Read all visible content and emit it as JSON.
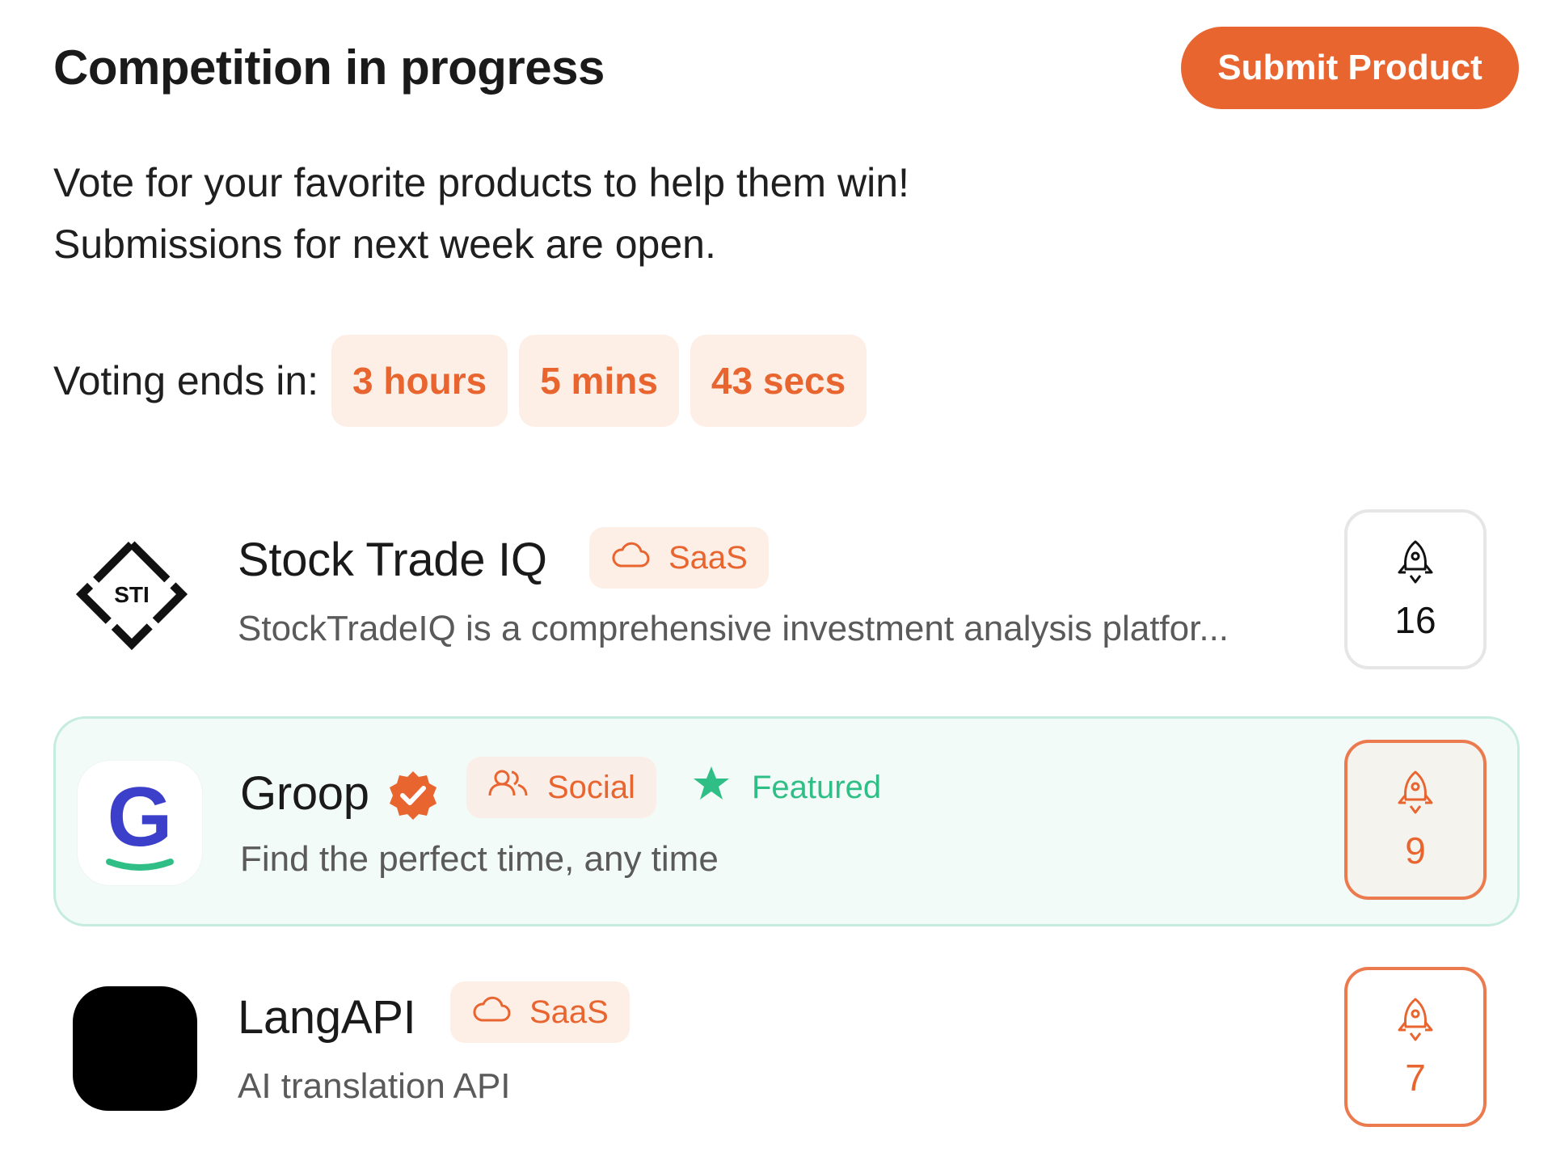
{
  "header": {
    "title": "Competition in progress",
    "submit_label": "Submit Product"
  },
  "intro": {
    "line1": "Vote for your favorite products to help them win!",
    "line2": "Submissions for next week are open."
  },
  "countdown": {
    "label": "Voting ends in:",
    "hours": "3 hours",
    "mins": "5 mins",
    "secs": "43 secs"
  },
  "products": [
    {
      "name": "Stock Trade IQ",
      "logo_text": "STI",
      "category": "SaaS",
      "category_icon": "cloud-icon",
      "description": "StockTradeIQ is a comprehensive investment analysis platfor...",
      "votes": "16"
    },
    {
      "name": "Groop",
      "logo_text": "G",
      "verified": true,
      "category": "Social",
      "category_icon": "users-icon",
      "featured_label": "Featured",
      "description": "Find the perfect time, any time",
      "votes": "9"
    },
    {
      "name": "LangAPI",
      "category": "SaaS",
      "category_icon": "cloud-icon",
      "description": "AI translation API",
      "votes": "7"
    }
  ],
  "colors": {
    "accent": "#e8652f",
    "chip_bg": "#fdeee6",
    "featured_green": "#2fbf86",
    "featured_bg": "#f3fbf8",
    "groop_blue": "#3b3fc9"
  }
}
